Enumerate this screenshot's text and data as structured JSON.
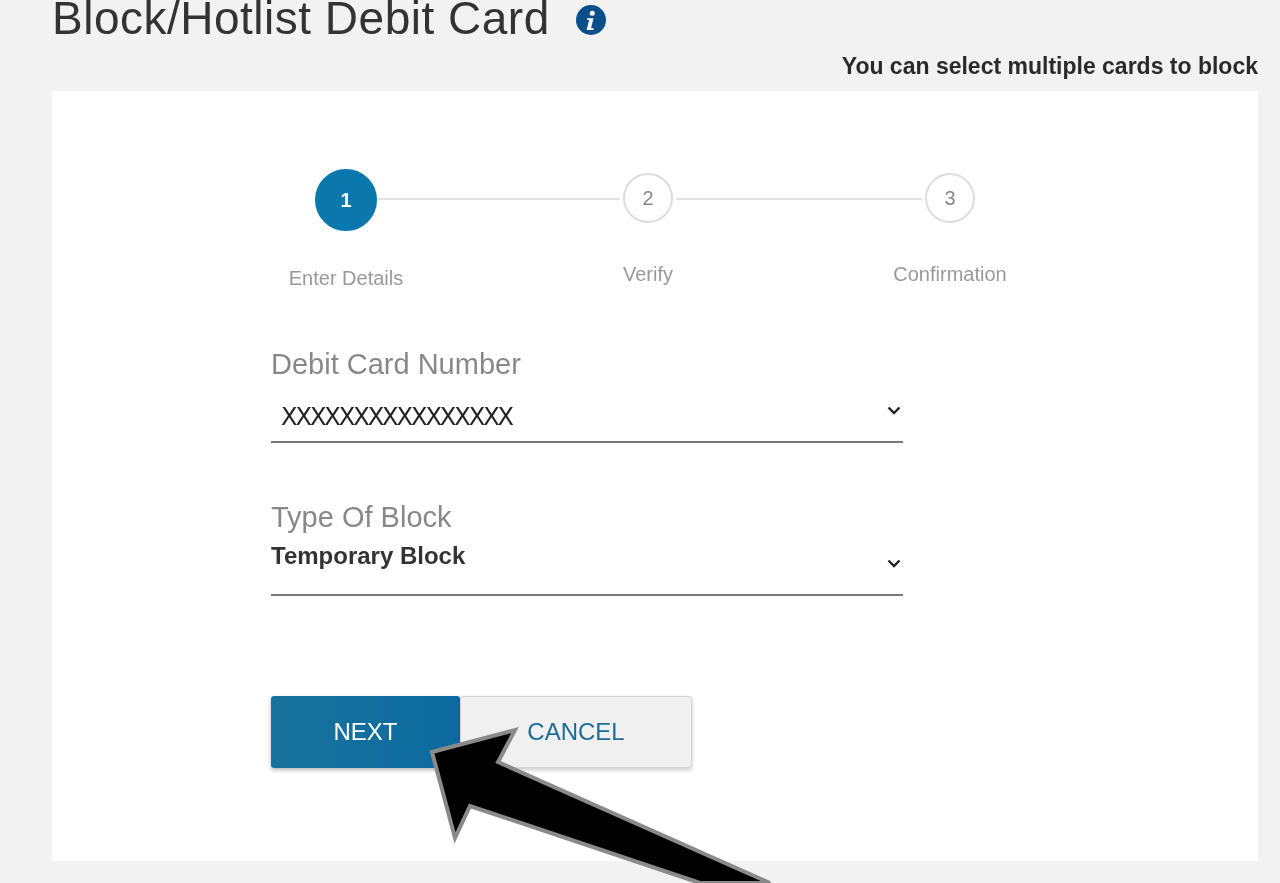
{
  "title": "Block/Hotlist Debit Card",
  "hint": "You can select multiple cards to block",
  "steps": [
    {
      "number": "1",
      "label": "Enter Details",
      "selected": true
    },
    {
      "number": "2",
      "label": "Verify",
      "selected": false
    },
    {
      "number": "3",
      "label": "Confirmation",
      "selected": false
    }
  ],
  "fields": [
    {
      "label": "Debit Card Number",
      "value": "XXXXXXXXXXXXXXXX",
      "kind": "masked"
    },
    {
      "label": "Type Of Block",
      "value": "Temporary Block",
      "kind": "bold"
    }
  ],
  "buttons": [
    {
      "label": "NEXT",
      "kind": "primary"
    },
    {
      "label": "CANCEL",
      "kind": "secondary"
    }
  ]
}
